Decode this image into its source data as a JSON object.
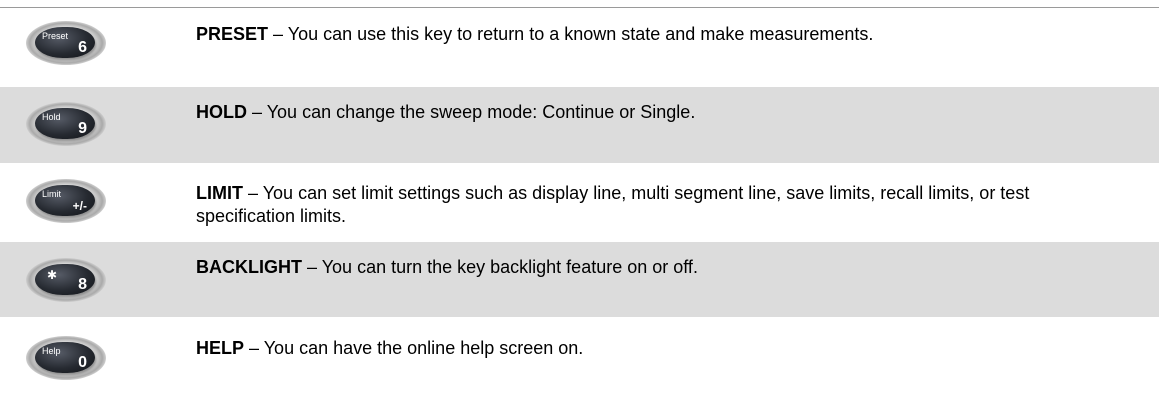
{
  "rows": [
    {
      "key": {
        "label": "Preset",
        "number": "6",
        "icon": "preset-6-key-icon"
      },
      "term": "PRESET",
      "text": " – You can use this key to return to a known state and make measurements."
    },
    {
      "key": {
        "label": "Hold",
        "number": "9",
        "icon": "hold-9-key-icon"
      },
      "term": "HOLD",
      "text": " – You can change the sweep mode: Continue or Single."
    },
    {
      "key": {
        "label": "Limit",
        "number": "+/-",
        "icon": "limit-plus-minus-key-icon"
      },
      "term": "LIMIT",
      "text": " – You can set limit settings such as display line, multi segment line, save limits, recall limits, or test specification limits."
    },
    {
      "key": {
        "label": "✱",
        "number": "8",
        "icon": "backlight-8-key-icon"
      },
      "term": "BACKLIGHT",
      "text": " – You can turn the key backlight feature on or off."
    },
    {
      "key": {
        "label": "Help",
        "number": "0",
        "icon": "help-0-key-icon"
      },
      "term": "HELP",
      "text": " – You can have the online help screen on."
    }
  ]
}
